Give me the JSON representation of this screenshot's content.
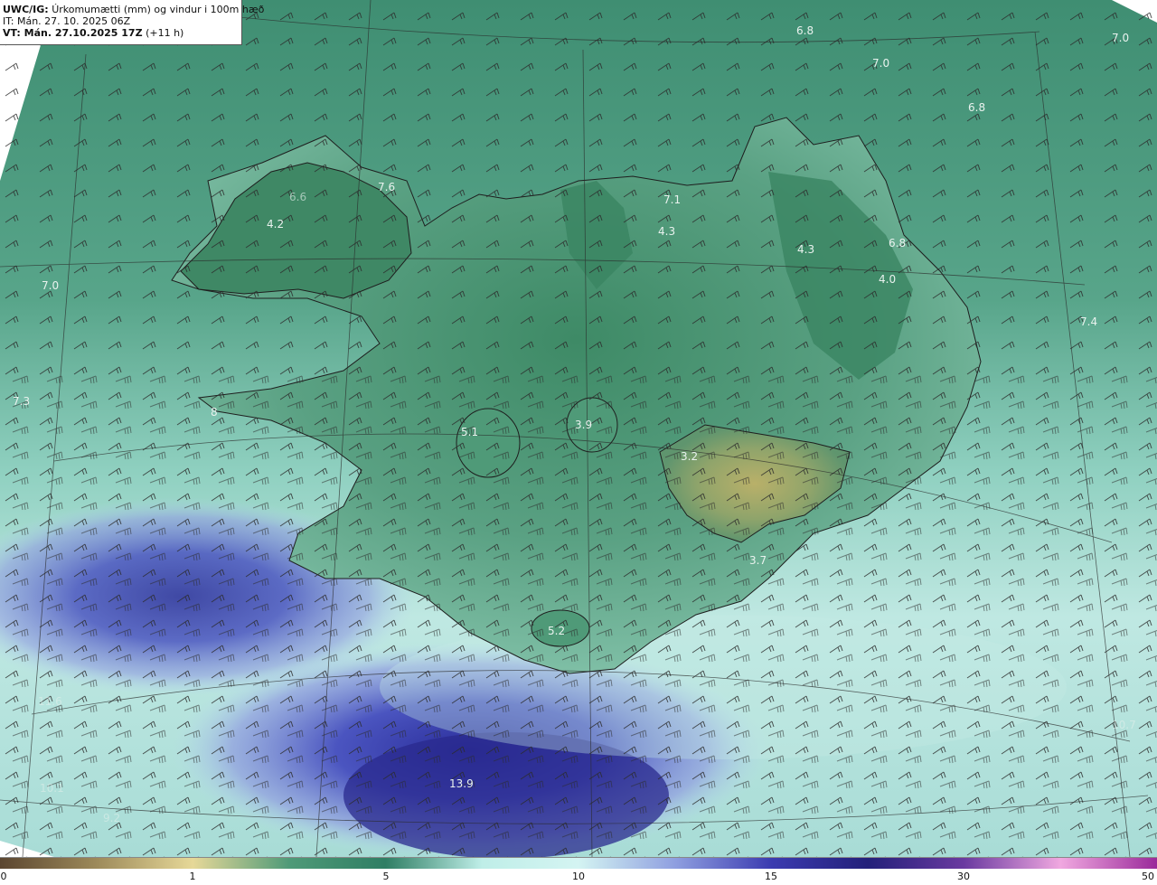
{
  "header": {
    "title_prefix": "UWC/IG:",
    "title_text": "Úrkomumætti (mm) og vindur i 100m hæð",
    "it_line": "IT: Mán. 27. 10. 2025 06Z",
    "vt_prefix": "VT: Mán. 27.10.2025 17Z",
    "vt_suffix": "(+11 h)"
  },
  "map_values": [
    {
      "text": "6.8"
    },
    {
      "text": "7.0"
    },
    {
      "text": "7.0"
    },
    {
      "text": "6.8"
    },
    {
      "text": "7.6"
    },
    {
      "text": "4.2"
    },
    {
      "text": "7.1"
    },
    {
      "text": "4.3"
    },
    {
      "text": "4.3"
    },
    {
      "text": "6.8"
    },
    {
      "text": "4.0"
    },
    {
      "text": "7.0"
    },
    {
      "text": "7.4"
    },
    {
      "text": "7.3"
    },
    {
      "text": "8"
    },
    {
      "text": "5.1"
    },
    {
      "text": "3.9"
    },
    {
      "text": "3.2"
    },
    {
      "text": "3.7"
    },
    {
      "text": "5.2"
    },
    {
      "text": "13.9"
    },
    {
      "text": "11.6"
    },
    {
      "text": "10.1"
    },
    {
      "text": "10.7"
    },
    {
      "text": "9.2"
    },
    {
      "text": "6.6"
    }
  ],
  "colorbar": {
    "ticks": [
      "0",
      "1",
      "5",
      "10",
      "15",
      "30",
      "50"
    ],
    "colors": [
      "#5b4630",
      "#9d8a5a",
      "#e6d898",
      "#4f9a78",
      "#2f7e64",
      "#bfeee8",
      "#d4f4f2",
      "#8f9fe0",
      "#3b3bb0",
      "#23207a",
      "#6a3aa0",
      "#f0a8e0",
      "#9a2a9a"
    ]
  }
}
